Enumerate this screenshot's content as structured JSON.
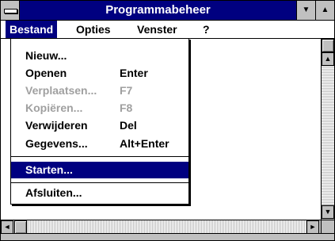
{
  "window": {
    "title": "Programmabeheer",
    "minimize_glyph": "▼",
    "maximize_glyph": "▲"
  },
  "menubar": {
    "items": [
      {
        "label": "Bestand",
        "active": true
      },
      {
        "label": "Opties",
        "active": false
      },
      {
        "label": "Venster",
        "active": false
      },
      {
        "label": "?",
        "active": false
      }
    ]
  },
  "bestand_menu": {
    "items": [
      {
        "label": "Nieuw...",
        "shortcut": "",
        "enabled": true,
        "highlighted": false
      },
      {
        "label": "Openen",
        "shortcut": "Enter",
        "enabled": true,
        "highlighted": false
      },
      {
        "label": "Verplaatsen...",
        "shortcut": "F7",
        "enabled": false,
        "highlighted": false
      },
      {
        "label": "Kopiëren...",
        "shortcut": "F8",
        "enabled": false,
        "highlighted": false
      },
      {
        "label": "Verwijderen",
        "shortcut": "Del",
        "enabled": true,
        "highlighted": false
      },
      {
        "label": "Gegevens...",
        "shortcut": "Alt+Enter",
        "enabled": true,
        "highlighted": false
      },
      {
        "label": "Starten...",
        "shortcut": "",
        "enabled": true,
        "highlighted": true
      },
      {
        "label": "Afsluiten...",
        "shortcut": "",
        "enabled": true,
        "highlighted": false
      }
    ]
  },
  "scrollbars": {
    "up_arrow": "▲",
    "down_arrow": "▼",
    "left_arrow": "◄",
    "right_arrow": "►"
  },
  "colors": {
    "title_bar": "#000080",
    "highlight": "#000080",
    "disabled_text": "#a0a0a0",
    "chrome": "#c0c0c0"
  }
}
